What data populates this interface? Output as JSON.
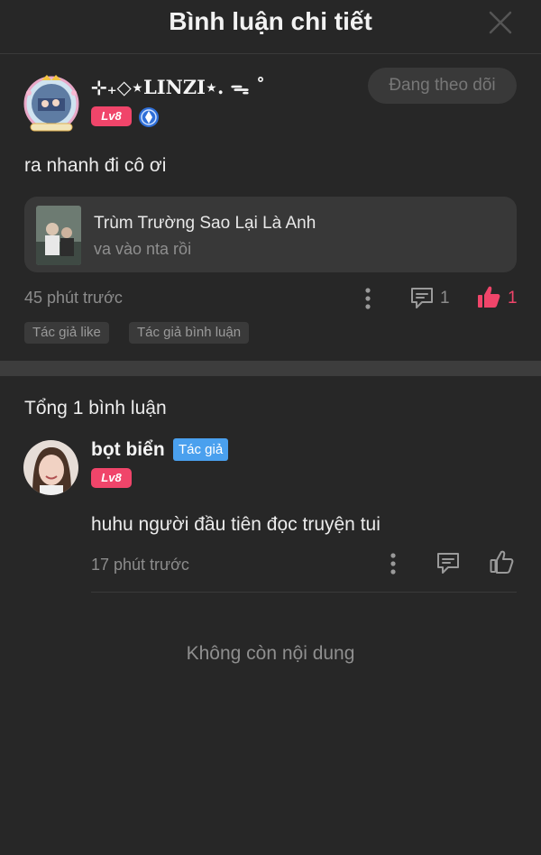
{
  "header": {
    "title": "Bình luận chi tiết",
    "close_icon": "close-icon"
  },
  "comment": {
    "username": "⊹₊◇⋆LINZI⋆. ᯓ ˚",
    "level": "Lv8",
    "follow_label": "Đang theo dõi",
    "text": "ra nhanh đi cô ơi",
    "story": {
      "title": "Trùm Trường Sao Lại Là Anh",
      "subtitle": "va vào nta rồi"
    },
    "time": "45 phút trước",
    "reply_count": "1",
    "like_count": "1",
    "tags": [
      "Tác giả like",
      "Tác giả bình luận"
    ]
  },
  "replies": {
    "total_label": "Tổng 1 bình luận",
    "items": [
      {
        "name": "bọt biển",
        "badge": "Tác giả",
        "level": "Lv8",
        "text": "huhu người đầu tiên đọc truyện tui",
        "time": "17 phút trước"
      }
    ]
  },
  "end_text": "Không còn nội dung",
  "colors": {
    "background": "#272727",
    "accent_like": "#f0456a",
    "author_badge": "#4aa0ee",
    "level_badge": "#f0456a"
  }
}
